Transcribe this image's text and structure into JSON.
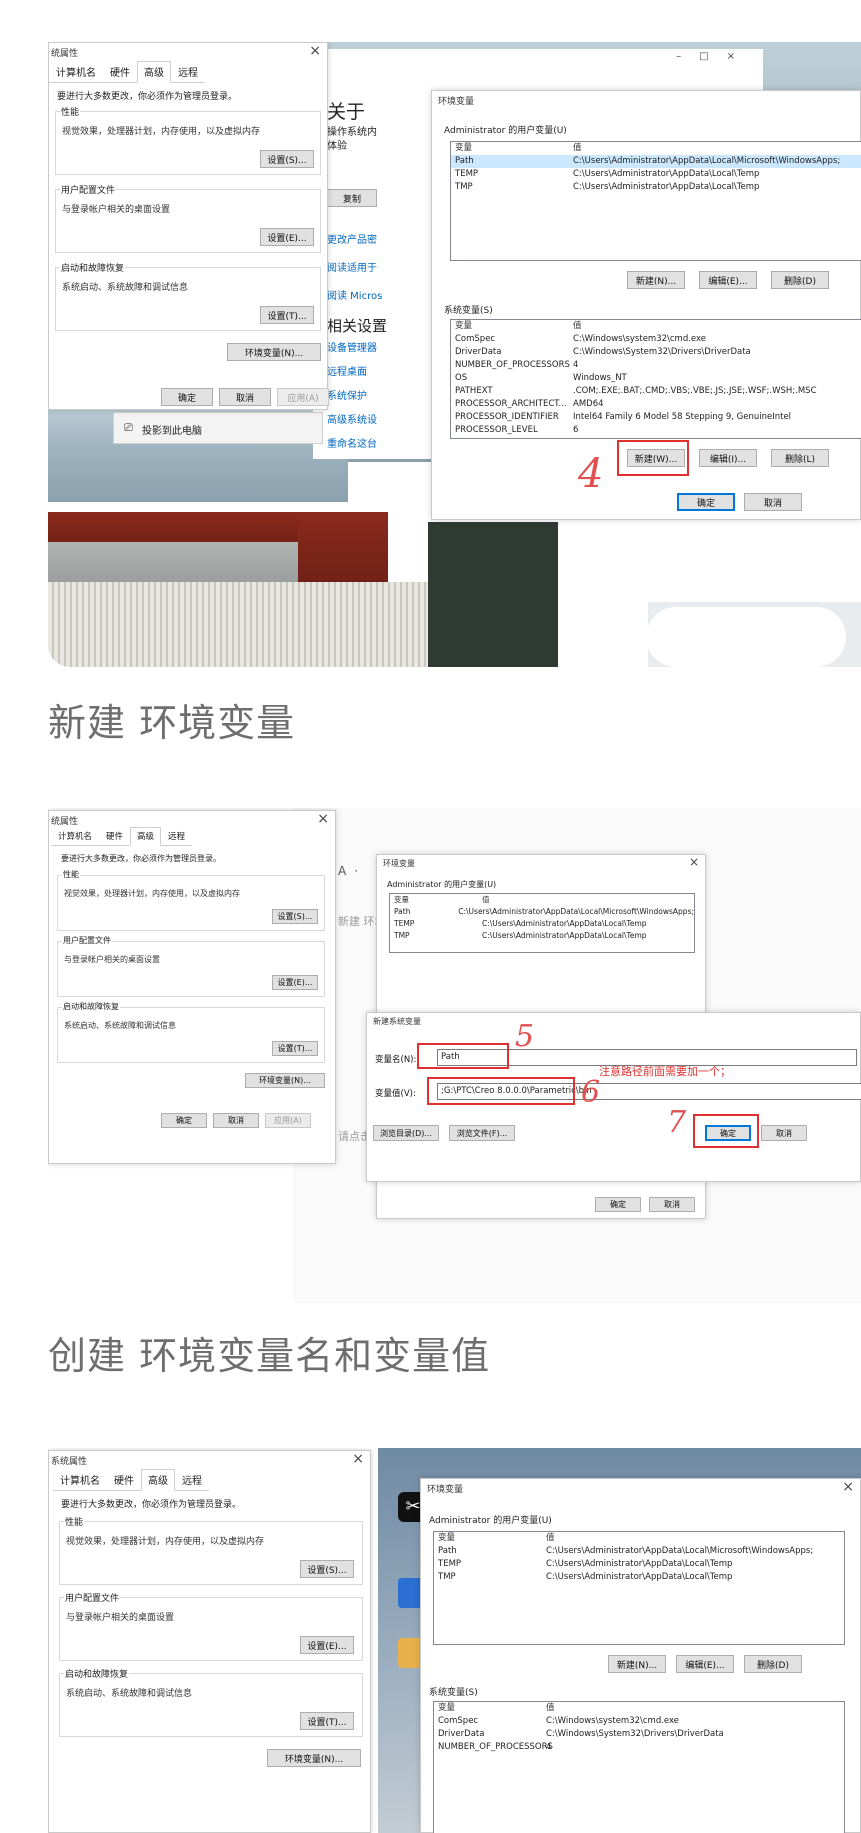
{
  "sys_props": {
    "title": "系统属性",
    "title_short": "统属性",
    "tabs": [
      "计算机名",
      "硬件",
      "高级",
      "远程"
    ],
    "admin_note": "要进行大多数更改，你必须作为管理员登录。",
    "perf": {
      "label": "性能",
      "desc": "视觉效果，处理器计划，内存使用，以及虚拟内存",
      "btn": "设置(S)..."
    },
    "profile": {
      "label": "用户配置文件",
      "desc": "与登录帐户相关的桌面设置",
      "btn": "设置(E)..."
    },
    "startup": {
      "label": "启动和故障恢复",
      "desc": "系统启动、系统故障和调试信息",
      "btn": "设置(T)..."
    },
    "env_btn": "环境变量(N)...",
    "ok": "确定",
    "cancel": "取消",
    "apply": "应用(A)"
  },
  "about": {
    "heading": "关于",
    "line1": "操作系统内",
    "line2": "体验",
    "copy_btn": "复制",
    "links": [
      "更改产品密",
      "阅读适用于",
      "阅读 Micros"
    ],
    "related": "相关设置",
    "related_links": [
      "设备管理器",
      "远程桌面",
      "系统保护",
      "高级系统设",
      "重命名这台"
    ],
    "project": "投影到此电脑"
  },
  "env_dialog": {
    "title": "环境变量",
    "user_section": "Administrator 的用户变量(U)",
    "col_var": "变量",
    "col_val": "值",
    "user_vars": [
      {
        "name": "Path",
        "value": "C:\\Users\\Administrator\\AppData\\Local\\Microsoft\\WindowsApps;"
      },
      {
        "name": "TEMP",
        "value": "C:\\Users\\Administrator\\AppData\\Local\\Temp"
      },
      {
        "name": "TMP",
        "value": "C:\\Users\\Administrator\\AppData\\Local\\Temp"
      }
    ],
    "user_new": "新建(N)...",
    "user_edit": "编辑(E)...",
    "user_delete": "删除(D)",
    "sys_section": "系统变量(S)",
    "sys_vars": [
      {
        "name": "ComSpec",
        "value": "C:\\Windows\\system32\\cmd.exe"
      },
      {
        "name": "DriverData",
        "value": "C:\\Windows\\System32\\Drivers\\DriverData"
      },
      {
        "name": "NUMBER_OF_PROCESSORS",
        "value": "4"
      },
      {
        "name": "OS",
        "value": "Windows_NT"
      },
      {
        "name": "PATHEXT",
        "value": ".COM;.EXE;.BAT;.CMD;.VBS;.VBE;.JS;.JSE;.WSF;.WSH;.MSC"
      },
      {
        "name": "PROCESSOR_ARCHITECT...",
        "value": "AMD64"
      },
      {
        "name": "PROCESSOR_IDENTIFIER",
        "value": "Intel64 Family 6 Model 58 Stepping 9, GenuineIntel"
      },
      {
        "name": "PROCESSOR_LEVEL",
        "value": "6"
      }
    ],
    "sys_new": "新建(W)...",
    "sys_edit": "编辑(I)...",
    "sys_delete": "删除(L)",
    "ok": "确定",
    "cancel": "取消"
  },
  "new_var": {
    "title": "新建系统变量",
    "name_label": "变量名(N):",
    "name_value": "Path",
    "value_label": "变量值(V):",
    "value_value": ";G:\\PTC\\Creo 8.0.0.0\\Parametric\\bin",
    "browse_dir": "浏览目录(D)...",
    "browse_file": "浏览文件(F)...",
    "ok": "确定",
    "cancel": "取消",
    "annotation": "注意路径前面需要加一个；"
  },
  "steps": {
    "s4": "4",
    "s5": "5",
    "s6": "6",
    "s7": "7"
  },
  "captions": {
    "c1": "新建 环境变量",
    "c2": "创建 环境变量名和变量值"
  },
  "desktop": {
    "fragment2": "新建 环境",
    "fragment3": "请点击"
  }
}
